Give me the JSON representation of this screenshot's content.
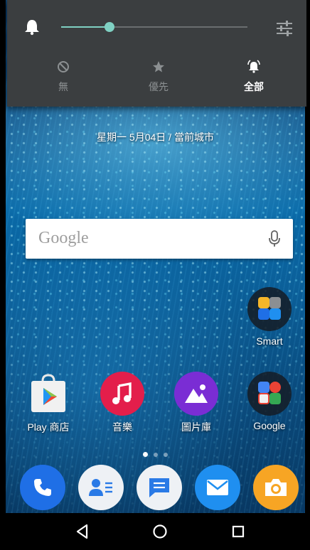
{
  "quick_settings": {
    "volume_level": 0.26,
    "modes": [
      {
        "label": "無",
        "icon": "block-icon",
        "active": false
      },
      {
        "label": "優先",
        "icon": "star-icon",
        "active": false
      },
      {
        "label": "全部",
        "icon": "bell-ringing-icon",
        "active": true
      }
    ]
  },
  "home": {
    "date_text": "星期一 5月04日 / 當前城市",
    "search": {
      "label": "Google",
      "icon": "mic-icon"
    },
    "folders": [
      {
        "label": "Smart",
        "icon": "folder-icon"
      },
      {
        "label": "Google",
        "icon": "folder-icon"
      }
    ],
    "apps": [
      {
        "label": "Play 商店",
        "icon": "play-store-icon"
      },
      {
        "label": "音樂",
        "icon": "music-icon"
      },
      {
        "label": "圖片庫",
        "icon": "gallery-icon"
      }
    ],
    "page_indicator": {
      "pages": 3,
      "current": 1
    }
  },
  "dock": [
    {
      "icon": "phone-icon",
      "color": "#1f6fe6"
    },
    {
      "icon": "contacts-icon",
      "color": "#eef1f5"
    },
    {
      "icon": "messages-icon",
      "color": "#eef1f5"
    },
    {
      "icon": "email-icon",
      "color": "#1f8ff0"
    },
    {
      "icon": "camera-icon",
      "color": "#f7a524"
    }
  ],
  "navbar": [
    {
      "icon": "back-icon"
    },
    {
      "icon": "home-icon"
    },
    {
      "icon": "recents-icon"
    }
  ]
}
